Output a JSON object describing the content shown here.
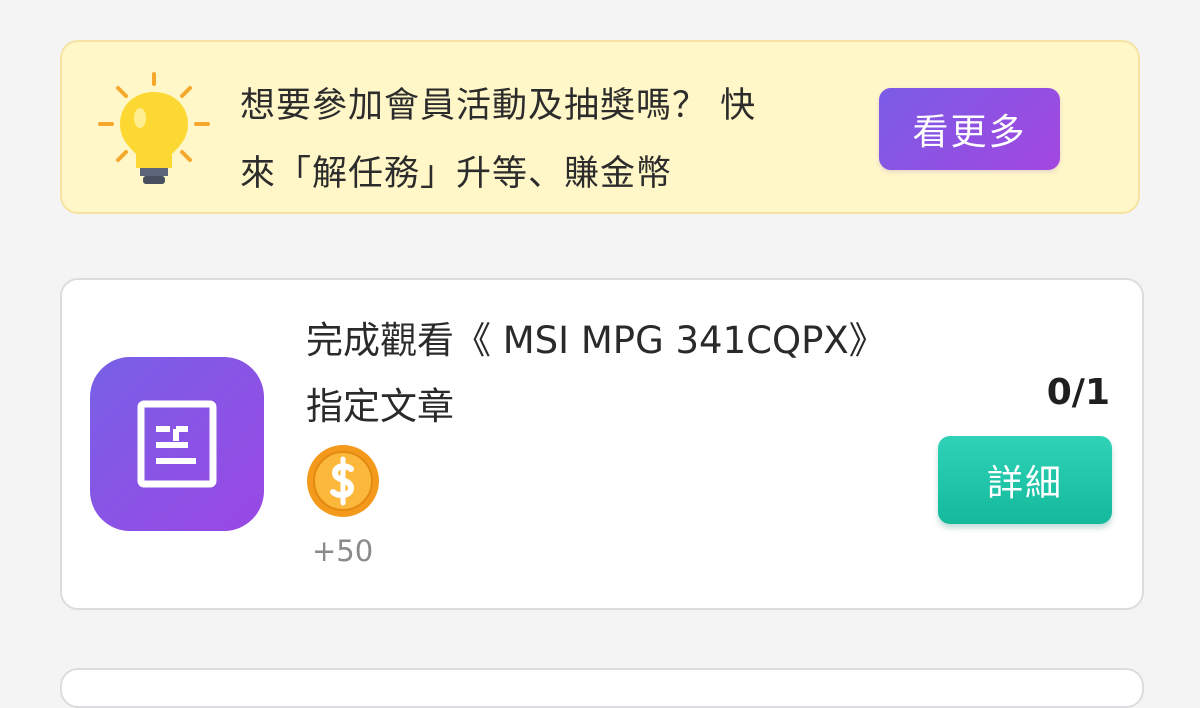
{
  "promo": {
    "line1": "想要參加會員活動及抽獎嗎？ 快",
    "line2": "來「解任務」升等、賺金幣",
    "button_label": "看更多",
    "icon": "lightbulb-icon"
  },
  "task": {
    "title_line1": "完成觀看《 MSI MPG 341CQPX》",
    "title_line2": "指定文章",
    "icon": "article-icon",
    "reward_icon": "coin-icon",
    "reward_amount": "+50",
    "progress": "0/1",
    "button_label": "詳細"
  },
  "colors": {
    "promo_bg": "#fff7c8",
    "promo_button": "#8b52e3",
    "task_icon_bg": "#8954e5",
    "detail_button": "#1fc4a6",
    "coin": "#f5a623"
  }
}
